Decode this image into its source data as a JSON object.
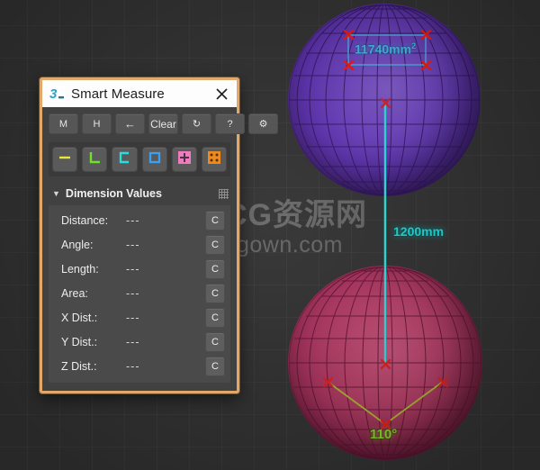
{
  "app": {
    "viewport_bg": "#363636",
    "grid_color": "#4a4a4a"
  },
  "panel": {
    "title": "Smart Measure",
    "logo_icon": "3dsmax-logo-icon",
    "close_icon": "close-icon",
    "border_color": "#e2a86a",
    "toolbar": [
      {
        "name": "mirror-button",
        "label": "M"
      },
      {
        "name": "hide-button",
        "label": "H"
      },
      {
        "name": "back-button",
        "label": "←"
      },
      {
        "name": "clear-button",
        "label": "Clear"
      },
      {
        "name": "refresh-button",
        "label": "↻"
      },
      {
        "name": "help-button",
        "label": "?"
      },
      {
        "name": "settings-button",
        "label": "⚙"
      }
    ],
    "modes": [
      {
        "name": "mode-distance",
        "icon": "dash-icon",
        "color": "#e8e83c",
        "selected": false
      },
      {
        "name": "mode-angle",
        "icon": "angle-l-icon",
        "color": "#6ee22a",
        "selected": false
      },
      {
        "name": "mode-length",
        "icon": "perimeter-c-icon",
        "color": "#26dede",
        "selected": false
      },
      {
        "name": "mode-area",
        "icon": "square-outline-icon",
        "color": "#3aa0f5",
        "selected": false
      },
      {
        "name": "mode-point",
        "icon": "crosshair-square-icon",
        "color": "#f07ac0",
        "selected": false
      },
      {
        "name": "mode-multi",
        "icon": "dotted-square-icon",
        "color": "#f08a1c",
        "selected": true
      }
    ],
    "rollout": {
      "title": "Dimension Values",
      "expanded": true,
      "arrow_icon": "chevron-down-icon",
      "grip_icon": "grip-dots-icon",
      "rows": [
        {
          "label": "Distance:",
          "value": "---",
          "copy_label": "C"
        },
        {
          "label": "Angle:",
          "value": "---",
          "copy_label": "C"
        },
        {
          "label": "Length:",
          "value": "---",
          "copy_label": "C"
        },
        {
          "label": "Area:",
          "value": "---",
          "copy_label": "C"
        },
        {
          "label": "X Dist.:",
          "value": "---",
          "copy_label": "C"
        },
        {
          "label": "Y Dist.:",
          "value": "---",
          "copy_label": "C"
        },
        {
          "label": "Z Dist.:",
          "value": "---",
          "copy_label": "C"
        }
      ]
    }
  },
  "viewport": {
    "objects": [
      {
        "name": "sphere-purple",
        "color": "#6235b8"
      },
      {
        "name": "sphere-crimson",
        "color": "#b33763"
      }
    ],
    "measurements": {
      "area": {
        "text": "11740mm",
        "unit_sup": "2",
        "color": "#4fc3f7"
      },
      "distance": {
        "text": "1200mm",
        "color": "#25e0e0"
      },
      "angle": {
        "text": "110°",
        "color": "#8ee82b"
      }
    }
  },
  "watermark": {
    "cn": "CG资源网",
    "en": "cgown.com",
    "logo_icon": "cg-cube-logo-icon"
  }
}
